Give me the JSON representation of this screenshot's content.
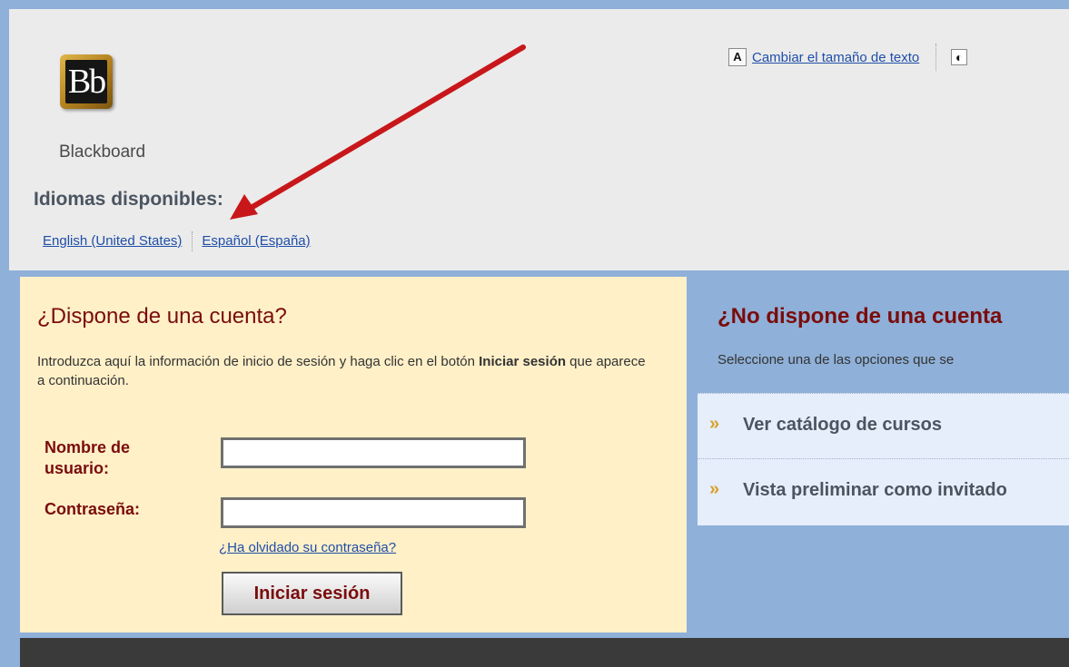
{
  "header": {
    "logo_text": "Bb",
    "logo_caption": "Blackboard",
    "languages_title": "Idiomas disponibles:",
    "languages": [
      "English (United States)",
      "Español (España)"
    ],
    "tools": {
      "text_size_icon": "text-size-icon",
      "text_size_label": "Cambiar el tamaño de texto",
      "contrast_icon": "contrast-icon"
    }
  },
  "login": {
    "title": "¿Dispone de una cuenta?",
    "intro_before": "Introduzca aquí la información de inicio de sesión y haga clic en el botón ",
    "intro_bold": "Iniciar sesión",
    "intro_after": " que aparece a continuación.",
    "username_label": "Nombre de usuario:",
    "password_label": "Contraseña:",
    "username_value": "",
    "password_value": "",
    "forgot_link": "¿Ha olvidado su contraseña?",
    "submit_label": "Iniciar sesión"
  },
  "no_account": {
    "title": "¿No dispone de una cuenta",
    "intro": "Seleccione una de las opciones que se",
    "options": [
      {
        "icon": "double-chevron-icon",
        "label": "Ver catálogo de cursos"
      },
      {
        "icon": "double-chevron-icon",
        "label": "Vista preliminar como invitado"
      }
    ]
  },
  "colors": {
    "page_bg": "#8fb0d8",
    "header_bg": "#ebebeb",
    "login_bg": "#fff0c8",
    "heading_red": "#7a0c0c",
    "link_blue": "#1f4ea8",
    "arrow_red": "#c8171a"
  }
}
